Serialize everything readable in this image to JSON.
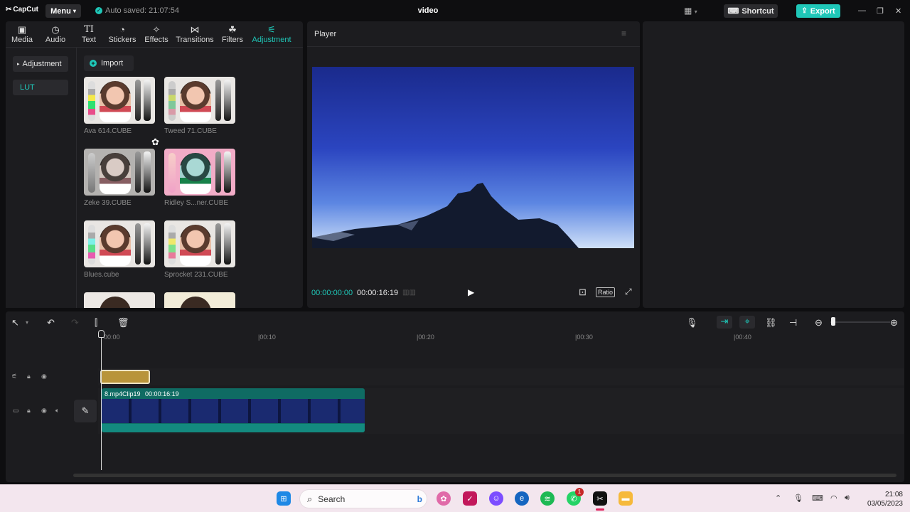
{
  "app": {
    "logo_text": "CapCut",
    "menu_label": "Menu",
    "autosave_text": "Auto saved: 21:07:54",
    "project_title": "video",
    "shortcut_label": "Shortcut",
    "export_label": "Export"
  },
  "tabs": [
    {
      "label": "Media",
      "icon": "media-icon"
    },
    {
      "label": "Audio",
      "icon": "audio-icon"
    },
    {
      "label": "Text",
      "icon": "text-icon"
    },
    {
      "label": "Stickers",
      "icon": "stickers-icon"
    },
    {
      "label": "Effects",
      "icon": "effects-icon"
    },
    {
      "label": "Transitions",
      "icon": "transitions-icon"
    },
    {
      "label": "Filters",
      "icon": "filters-icon"
    },
    {
      "label": "Adjustment",
      "icon": "adjustment-icon",
      "active": true
    }
  ],
  "sidebar": {
    "items": [
      {
        "label": "Adjustment"
      },
      {
        "label": "LUT"
      }
    ]
  },
  "import_label": "Import",
  "luts": [
    {
      "name": "Ava 614.CUBE"
    },
    {
      "name": "Tweed 71.CUBE"
    },
    {
      "name": "Zeke 39.CUBE"
    },
    {
      "name": "Ridley S...ner.CUBE"
    },
    {
      "name": "Blues.cube"
    },
    {
      "name": "Sprocket 231.CUBE"
    }
  ],
  "player": {
    "title": "Player",
    "current_time": "00:00:00:00",
    "duration": "00:00:16:19",
    "ratio_label": "Ratio"
  },
  "timeline": {
    "ruler_labels": [
      "00:00",
      "|00:10",
      "|00:20",
      "|00:30",
      "|00:40"
    ],
    "clip_label": "8.mp4",
    "clip_name": "Clip19",
    "clip_duration": "00:00:16:19"
  },
  "taskbar": {
    "search_placeholder": "Search",
    "time": "21:08",
    "date": "03/05/2023",
    "whatsapp_badge": "1"
  },
  "colors": {
    "accent": "#1fc7b8",
    "panel": "#1c1c1f",
    "adjustment_clip": "#b8943a",
    "video_clip": "#0f6b63"
  }
}
